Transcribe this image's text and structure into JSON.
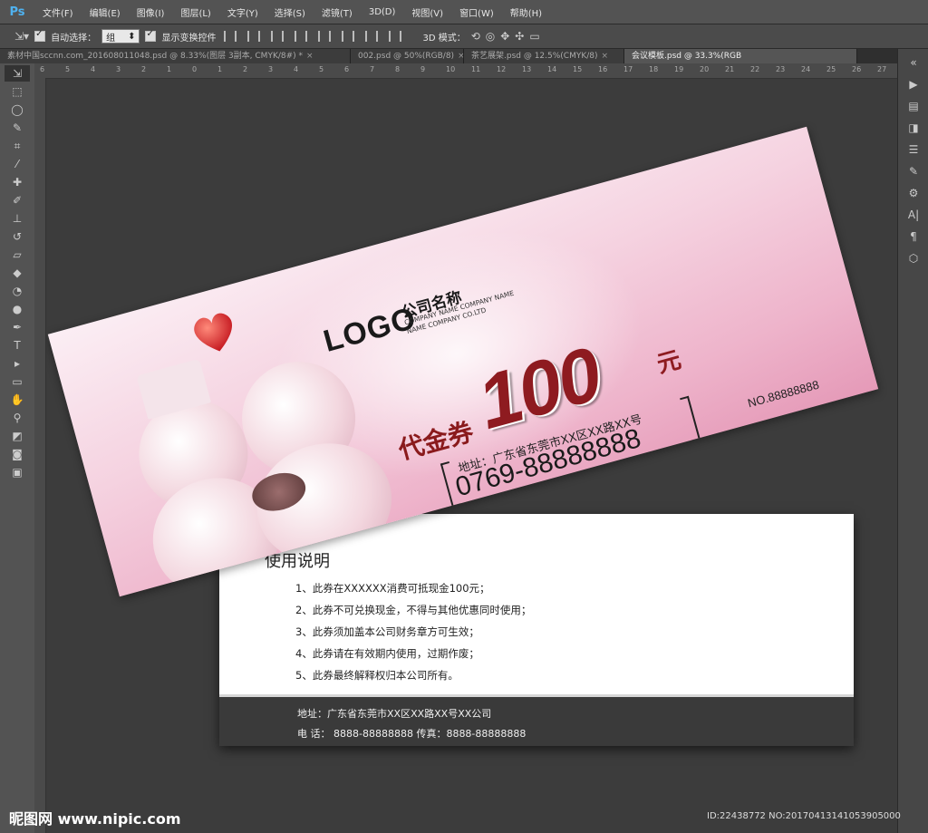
{
  "app": {
    "logo": "Ps"
  },
  "menu": [
    "文件(F)",
    "编辑(E)",
    "图像(I)",
    "图层(L)",
    "文字(Y)",
    "选择(S)",
    "滤镜(T)",
    "3D(D)",
    "视图(V)",
    "窗口(W)",
    "帮助(H)"
  ],
  "options": {
    "auto_select_label": "自动选择：",
    "auto_select_value": "组",
    "show_transform_label": "显示变换控件",
    "mode_3d_label": "3D 模式："
  },
  "tabs": [
    {
      "label": "素材中国sccnn.com_20160801104​8.psd @ 8.33%(图层 3副本, CMYK/8#) *",
      "active": false
    },
    {
      "label": "002.psd @ 50%(RGB/8)",
      "active": false
    },
    {
      "label": "茶艺展架.psd @ 12.5%(CMYK/8)",
      "active": false
    },
    {
      "label": "会议模板.psd @ 33.3%(RGB",
      "active": true
    }
  ],
  "ruler": [
    "6",
    "5",
    "4",
    "3",
    "2",
    "1",
    "0",
    "1",
    "2",
    "3",
    "4",
    "5",
    "6",
    "7",
    "8",
    "9",
    "10",
    "11",
    "12",
    "13",
    "14",
    "15",
    "16",
    "17",
    "18",
    "19",
    "20",
    "21",
    "22",
    "23",
    "24",
    "25",
    "26",
    "27"
  ],
  "ticket": {
    "logo": "LOGO",
    "company_cn": "公司名称",
    "company_en_line1": "COMPANY NAME COMPANY NAME",
    "company_en_line2": "NAME COMPANY CO.LTD",
    "voucher_label": "代金券",
    "amount": "100",
    "currency": "元",
    "address": "地址：广东省东莞市XX区XX路XX号",
    "phone": "0769-88888888",
    "serial": "NO.88888888"
  },
  "back": {
    "title": "使用说明",
    "rules": [
      "1、此券在XXXXXX消费可抵现金100元；",
      "2、此券不可兑换现金，不得与其他优惠同时使用；",
      "3、此券须加盖本公司财务章方可生效；",
      "4、此券请在有效期内使用，过期作废；",
      "5、此券最终解释权归本公司所有。"
    ],
    "footer_address": "地址：广东省东莞市XX区XX路XX号XX公司",
    "footer_phone": "电 话： 8888-88888888  传真：8888-88888888"
  },
  "watermark": {
    "left": "昵图网 www.nipic.com",
    "right": "ID:22438772 NO:20170413141053905000"
  },
  "colors": {
    "accent_red": "#8e1b20",
    "pink": "#eeb4cb"
  }
}
